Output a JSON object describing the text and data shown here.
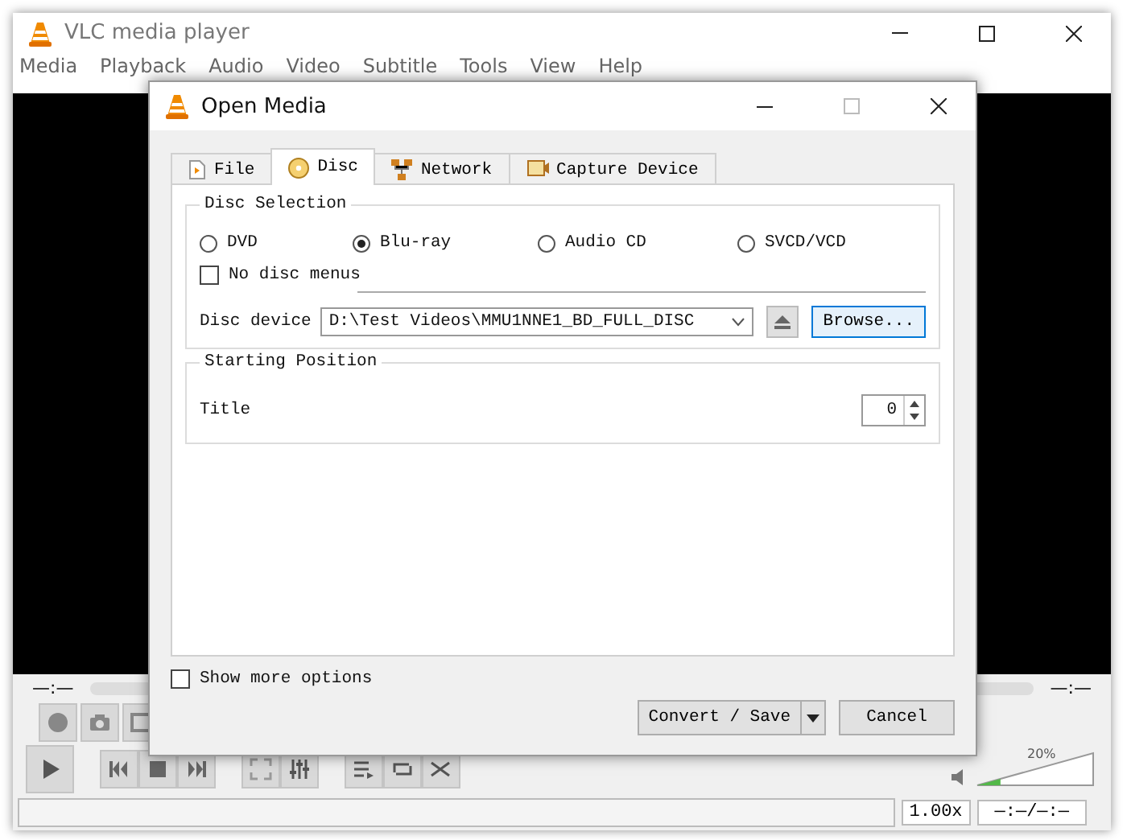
{
  "main_window": {
    "title": "VLC media player",
    "menu": [
      "Media",
      "Playback",
      "Audio",
      "Video",
      "Subtitle",
      "Tools",
      "View",
      "Help"
    ],
    "time_elapsed": "—:—",
    "time_total": "—:—",
    "volume": {
      "reading": "20%",
      "level": 0.2
    },
    "speed": "1.00x",
    "time_display": "—:—/—:—"
  },
  "dialog": {
    "title": "Open Media",
    "tabs": [
      {
        "label": "File",
        "selected": false
      },
      {
        "label": "Disc",
        "selected": true
      },
      {
        "label": "Network",
        "selected": false
      },
      {
        "label": "Capture Device",
        "selected": false
      }
    ],
    "disc_selection": {
      "legend": "Disc Selection",
      "disc_types": [
        {
          "label": "DVD",
          "selected": false
        },
        {
          "label": "Blu-ray",
          "selected": true
        },
        {
          "label": "Audio CD",
          "selected": false
        },
        {
          "label": "SVCD/VCD",
          "selected": false
        }
      ],
      "no_disc_menus": {
        "label": "No disc menus",
        "checked": false
      },
      "device_label": "Disc device",
      "device_value": "D:\\Test Videos\\MMU1NNE1_BD_FULL_DISC",
      "browse": "Browse..."
    },
    "starting_position": {
      "legend": "Starting Position",
      "title_label": "Title",
      "title_value": "0"
    },
    "show_more_options": {
      "label": "Show more options",
      "checked": false
    },
    "buttons": {
      "convert": "Convert / Save",
      "cancel": "Cancel"
    }
  }
}
